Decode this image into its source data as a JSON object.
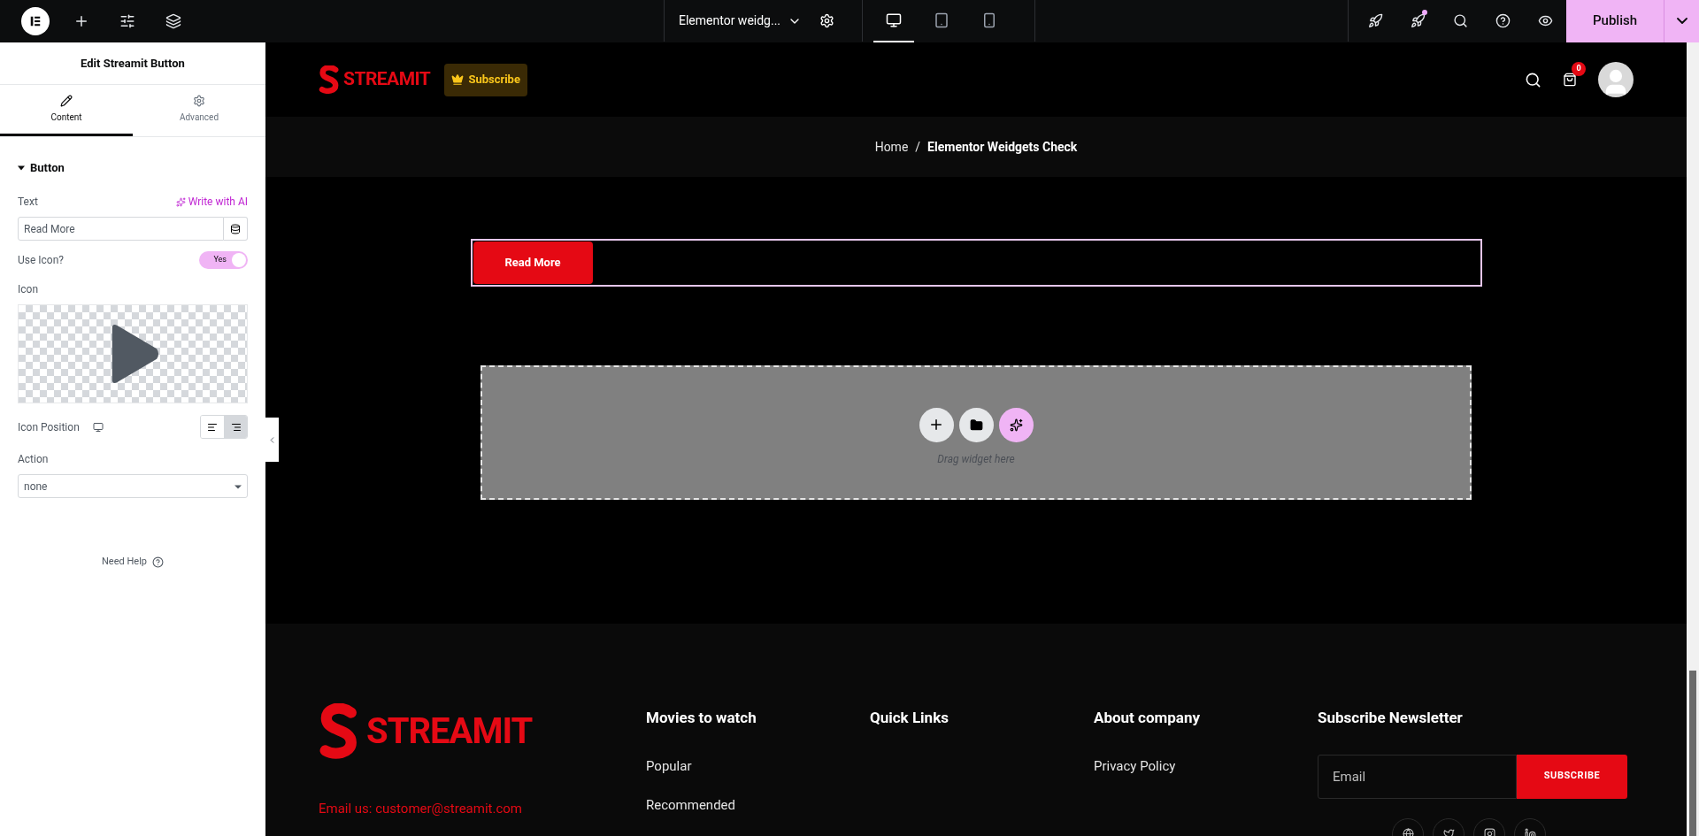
{
  "top_bar": {
    "page_title": "Elementor weidg...",
    "devices": [
      {
        "kind": "desktop",
        "selected": true
      },
      {
        "kind": "tablet",
        "selected": false
      },
      {
        "kind": "mobile",
        "selected": false
      }
    ],
    "publish": "Publish"
  },
  "panel": {
    "title": "Edit Streamit Button",
    "tabs": [
      {
        "label": "Content",
        "kind": "content",
        "selected": true
      },
      {
        "label": "Advanced",
        "kind": "advanced",
        "selected": false
      }
    ],
    "section": {
      "title": "Button",
      "expanded": true
    },
    "text_label": "Text",
    "ai_link": "Write with AI",
    "text_value": "Read More",
    "use_icon": {
      "label": "Use Icon?",
      "on": true,
      "on_text": "Yes"
    },
    "icon_label": "Icon",
    "icon_position": {
      "label": "Icon Position",
      "options": [
        {
          "kind": "before",
          "selected": false
        },
        {
          "kind": "after",
          "selected": true
        }
      ]
    },
    "action": {
      "label": "Action",
      "value": "none"
    },
    "help": "Need Help"
  },
  "site": {
    "header": {
      "logo": "STREAMIT",
      "subscribe": "Subscribe",
      "cart_count": "0"
    },
    "breadcrumb": {
      "home": "Home",
      "separator": "/",
      "current": "Elementor Weidgets Check"
    },
    "button": {
      "label": "Read More"
    },
    "drop_area": {
      "hint": "Drag widget here"
    },
    "footer": {
      "logo": "STREAMIT",
      "email": "Email us: customer@streamit.com",
      "columns": [
        {
          "heading": "Movies to watch",
          "links": [
            "Popular",
            "Recommended"
          ]
        },
        {
          "heading": "Quick Links"
        },
        {
          "heading": "About company",
          "links": [
            "Privacy Policy"
          ]
        }
      ],
      "newsletter": {
        "heading": "Subscribe Newsletter",
        "placeholder": "Email",
        "button": "SUBSCRIBE"
      }
    }
  }
}
